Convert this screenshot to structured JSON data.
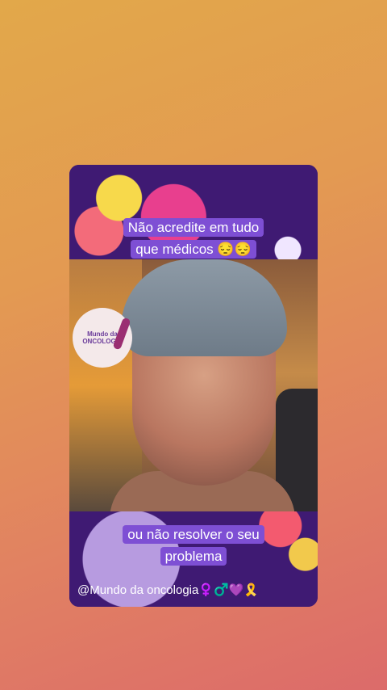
{
  "story": {
    "top_caption_line1": "Não acredite em tudo",
    "top_caption_line2": "que médicos 😔😔",
    "bottom_caption_line1": "ou não resolver o seu",
    "bottom_caption_line2": "problema",
    "handle": "@Mundo da oncologia",
    "handle_icons": "♀️♂️💜🎗️",
    "logo_text": "Mundo da ONCOLOGIA"
  }
}
